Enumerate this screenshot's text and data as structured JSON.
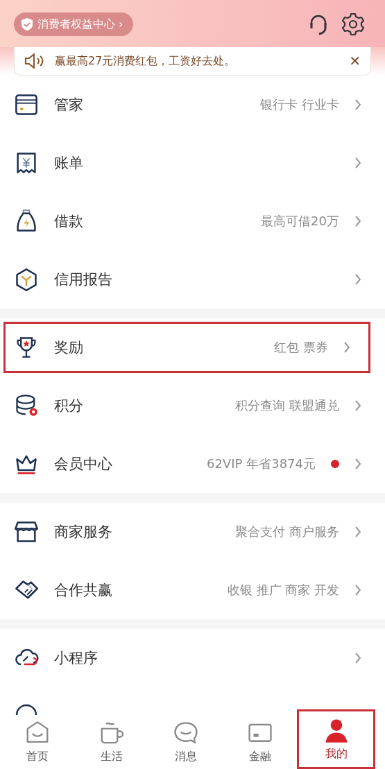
{
  "header": {
    "consumer_center": "消费者权益中心",
    "chevron": "›"
  },
  "notice": {
    "text": "赢最高27元消费红包，工资好去处。",
    "close": "✕"
  },
  "sections": [
    {
      "items": [
        {
          "label": "管家",
          "detail": "银行卡 行业卡",
          "badge": false,
          "highlighted": false
        },
        {
          "label": "账单",
          "badge": false,
          "highlighted": false
        },
        {
          "label": "借款",
          "detail": "最高可借20万",
          "badge": false,
          "highlighted": false
        },
        {
          "label": "信用报告",
          "badge": false,
          "highlighted": false
        }
      ]
    },
    {
      "items": [
        {
          "label": "奖励",
          "detail": "红包 票券",
          "badge": false,
          "highlighted": true
        },
        {
          "label": "积分",
          "detail": "积分查询 联盟通兑",
          "badge": false,
          "highlighted": false
        },
        {
          "label": "会员中心",
          "detail": "62VIP 年省3874元",
          "badge": true,
          "highlighted": false
        }
      ]
    },
    {
      "items": [
        {
          "label": "商家服务",
          "detail": "聚合支付 商户服务",
          "badge": false,
          "highlighted": false
        },
        {
          "label": "合作共赢",
          "detail": "收银 推广 商家 开发",
          "badge": false,
          "highlighted": false
        }
      ]
    },
    {
      "items": [
        {
          "label": "小程序",
          "badge": false,
          "highlighted": false
        }
      ]
    }
  ],
  "tab_bar": [
    {
      "label": "首页",
      "selected": false,
      "highlighted": false
    },
    {
      "label": "生活",
      "selected": false,
      "highlighted": false
    },
    {
      "label": "消息",
      "selected": false,
      "highlighted": false
    },
    {
      "label": "金融",
      "selected": false,
      "highlighted": false
    },
    {
      "label": "我的",
      "selected": true,
      "highlighted": true
    }
  ]
}
